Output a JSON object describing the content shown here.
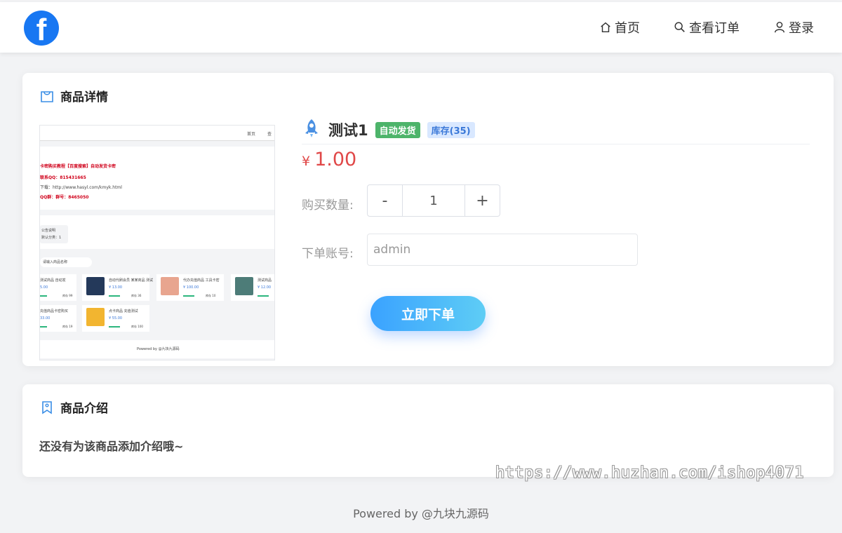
{
  "header": {
    "logo_icon": "facebook-logo",
    "brand_color": "#1877f2",
    "nav": [
      {
        "label": "首页",
        "icon": "home-icon"
      },
      {
        "label": "查看订单",
        "icon": "search-icon"
      },
      {
        "label": "登录",
        "icon": "user-icon"
      }
    ]
  },
  "detail": {
    "title": "商品详情",
    "product_name": "测试1",
    "badge_delivery": "自动发货",
    "badge_stock": "库存(35)",
    "price_currency": "¥",
    "price": "1.00",
    "quantity_label": "购买数量:",
    "quantity_minus": "-",
    "quantity_value": "1",
    "quantity_plus": "+",
    "account_label": "下单账号:",
    "account_placeholder": "admin",
    "order_button": "立即下单",
    "accent_color": "#3aa2ff",
    "price_color": "#e04848"
  },
  "preview": {
    "nav_home": "首页",
    "nav_orders": "查",
    "line1": "卡密购买教程【百度搜索】自动发货卡密",
    "line2": "联系QQ：815431665",
    "line3": "下载：http://www.hasyl.com/kmyk.html",
    "line4": "QQ群：群号：8465050",
    "notice_a": "公告说明",
    "notice_b": "默认分类：1",
    "search_hint": "请输入商品名称",
    "products": [
      {
        "name": "测试商品 自动发",
        "price": "5.00",
        "stock": "库存 99"
      },
      {
        "name": "自动代刷会员 某某商品 测试",
        "price": "¥ 13.00",
        "stock": "库存 36"
      },
      {
        "name": "代办充值商品 工具卡密",
        "price": "¥ 100.00",
        "stock": "库存 10"
      },
      {
        "name": "测试商品 ",
        "price": "¥ 12.00",
        "stock": "库存"
      },
      {
        "name": "充值商品卡密购买",
        "price": "33.00",
        "stock": "库存 19"
      },
      {
        "name": "点卡商品 充值测试",
        "price": "¥ 55.00",
        "stock": "库存 100"
      }
    ],
    "footer": "Powered by @九块九源码"
  },
  "intro": {
    "title": "商品介绍",
    "text": "还没有为该商品添加介绍哦~"
  },
  "watermark": "https://www.huzhan.com/ishop4071",
  "footer": "Powered by @九块九源码"
}
